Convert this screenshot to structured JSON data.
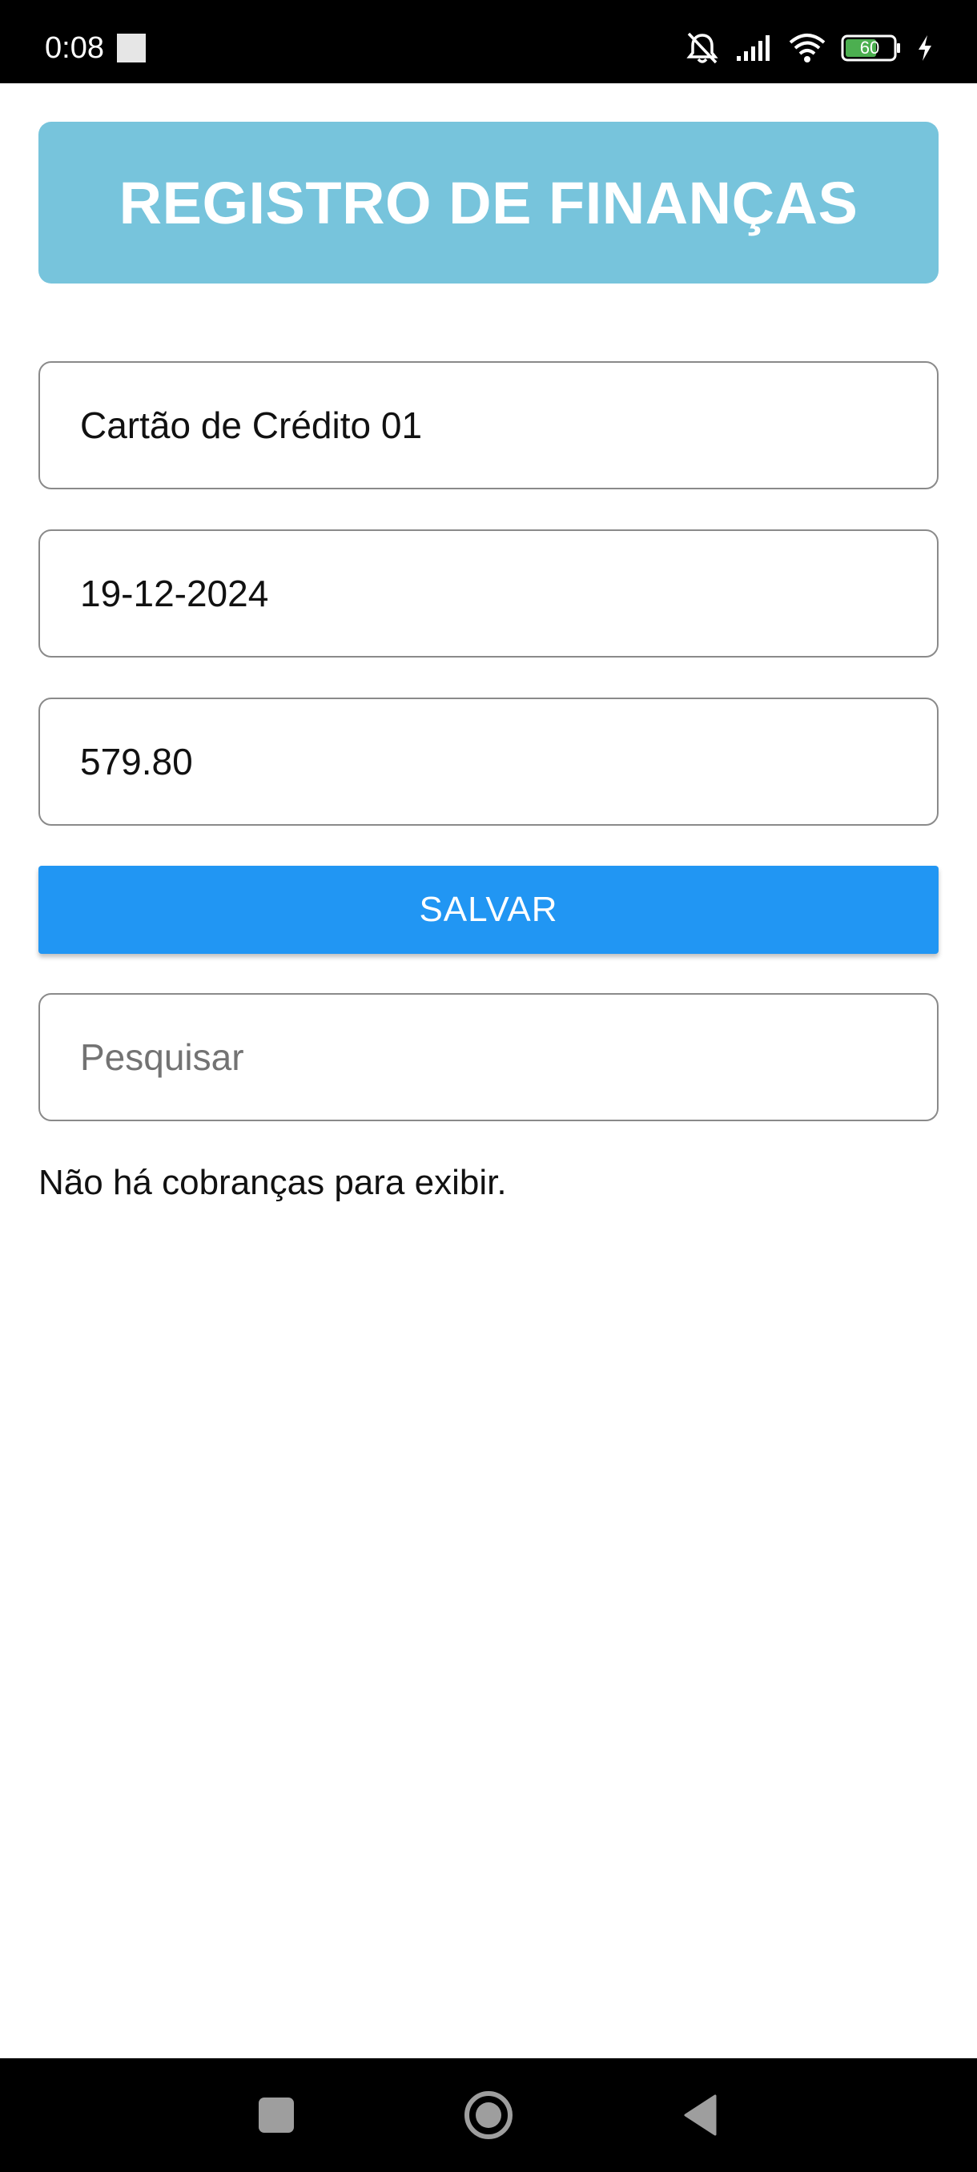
{
  "status_bar": {
    "time": "0:08",
    "battery": "60",
    "icons": [
      "notifications-off-icon",
      "signal-icon",
      "wifi-icon",
      "battery-icon",
      "charging-icon"
    ]
  },
  "header": {
    "title": "REGISTRO DE FINANÇAS"
  },
  "form": {
    "description_value": "Cartão de Crédito 01",
    "date_value": "19-12-2024",
    "amount_value": "579.80",
    "save_label": "SALVAR"
  },
  "search": {
    "placeholder": "Pesquisar",
    "value": ""
  },
  "list": {
    "empty_message": "Não há cobranças para exibir."
  },
  "colors": {
    "header": "#77c4dc",
    "button": "#2196f3"
  }
}
